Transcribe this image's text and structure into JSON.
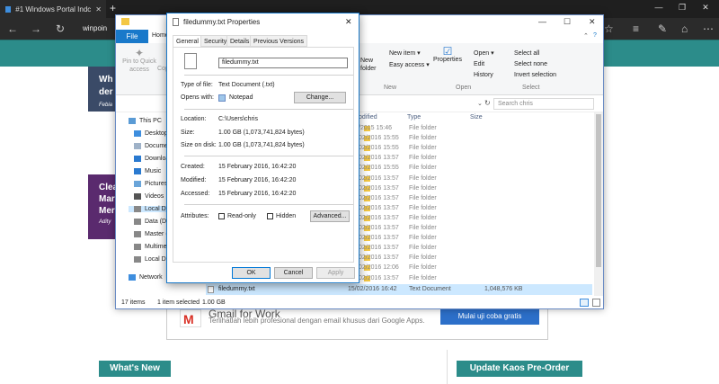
{
  "browser": {
    "tab_title": "#1 Windows Portal Indc",
    "address": "winpoin",
    "new_tab": "+",
    "min": "—",
    "max": "❐",
    "close": "✕",
    "tab_close": "✕"
  },
  "site": {
    "headline_top": "Wh",
    "headline_top2": "der",
    "byline_top": "Febia",
    "headline_mid": "Clea",
    "headline_mid2": "Mar",
    "headline_mid3": "Mer",
    "byline_mid": "Adity",
    "ad_title": "Gmail for Work",
    "ad_text": "Terlihatlah lebih profesional dengan email khusus dari Google Apps.",
    "ad_button": "Mulai uji coba gratis",
    "whats_new": "What's New",
    "kaos": "Update Kaos Pre-Order"
  },
  "explorer": {
    "file_tab": "File",
    "home_tab": "Home",
    "pin_label": "Pin to Quick access",
    "copy_label": "Copy",
    "new_item": "New item ▾",
    "easy_access": "Easy access ▾",
    "new_folder": "New folder",
    "properties": "Properties",
    "open": "Open ▾",
    "edit": "Edit",
    "history": "History",
    "select_all": "Select all",
    "select_none": "Select none",
    "invert_selection": "Invert selection",
    "group_new": "New",
    "group_open": "Open",
    "group_select": "Select",
    "search_placeholder": "Search chris",
    "col_modified": "odified",
    "col_type": "Type",
    "col_size": "Size",
    "nav": [
      "This PC",
      "Desktop",
      "Documen",
      "Download",
      "Music",
      "Pictures",
      "Videos",
      "Local Disk",
      "Data (D:)",
      "Master (E",
      "Multimed",
      "Local Disk",
      "Network"
    ],
    "rows": [
      {
        "date": "/2015 15:46",
        "type": "File folder"
      },
      {
        "date": "02/2016 15:55",
        "type": "File folder"
      },
      {
        "date": "02/2016 15:55",
        "type": "File folder"
      },
      {
        "date": "02/2016 13:57",
        "type": "File folder"
      },
      {
        "date": "02/2016 15:55",
        "type": "File folder"
      },
      {
        "date": "02/2016 13:57",
        "type": "File folder"
      },
      {
        "date": "02/2016 13:57",
        "type": "File folder"
      },
      {
        "date": "02/2016 13:57",
        "type": "File folder"
      },
      {
        "date": "02/2016 13:57",
        "type": "File folder"
      },
      {
        "date": "02/2016 13:57",
        "type": "File folder"
      },
      {
        "date": "02/2016 13:57",
        "type": "File folder"
      },
      {
        "date": "02/2016 13:57",
        "type": "File folder"
      },
      {
        "date": "02/2016 13:57",
        "type": "File folder"
      },
      {
        "date": "02/2016 13:57",
        "type": "File folder"
      },
      {
        "date": "02/2016 12:06",
        "type": "File folder"
      },
      {
        "date": "02/2016 13:57",
        "type": "File folder"
      }
    ],
    "selected_file": {
      "name": "filedummy.txt",
      "date": "15/02/2016 16:42",
      "type": "Text Document",
      "size": "1,048,576 KB"
    },
    "status_items": "17 items",
    "status_selected": "1 item selected",
    "status_size": "1.00 GB"
  },
  "dialog": {
    "title": "filedummy.txt Properties",
    "close": "✕",
    "tabs": [
      "General",
      "Security",
      "Details",
      "Previous Versions"
    ],
    "filename": "filedummy.txt",
    "type_label": "Type of file:",
    "type_value": "Text Document (.txt)",
    "opens_label": "Opens with:",
    "opens_value": "Notepad",
    "change_btn": "Change...",
    "location_label": "Location:",
    "location_value": "C:\\Users\\chris",
    "size_label": "Size:",
    "size_value": "1.00 GB (1,073,741,824 bytes)",
    "sizeondisk_label": "Size on disk:",
    "sizeondisk_value": "1.00 GB (1,073,741,824 bytes)",
    "created_label": "Created:",
    "created_value": "15 February 2016, 16:42:20",
    "modified_label": "Modified:",
    "modified_value": "15 February 2016, 16:42:20",
    "accessed_label": "Accessed:",
    "accessed_value": "15 February 2016, 16:42:20",
    "attributes_label": "Attributes:",
    "readonly_label": "Read-only",
    "hidden_label": "Hidden",
    "advanced_btn": "Advanced...",
    "ok": "OK",
    "cancel": "Cancel",
    "apply": "Apply"
  }
}
